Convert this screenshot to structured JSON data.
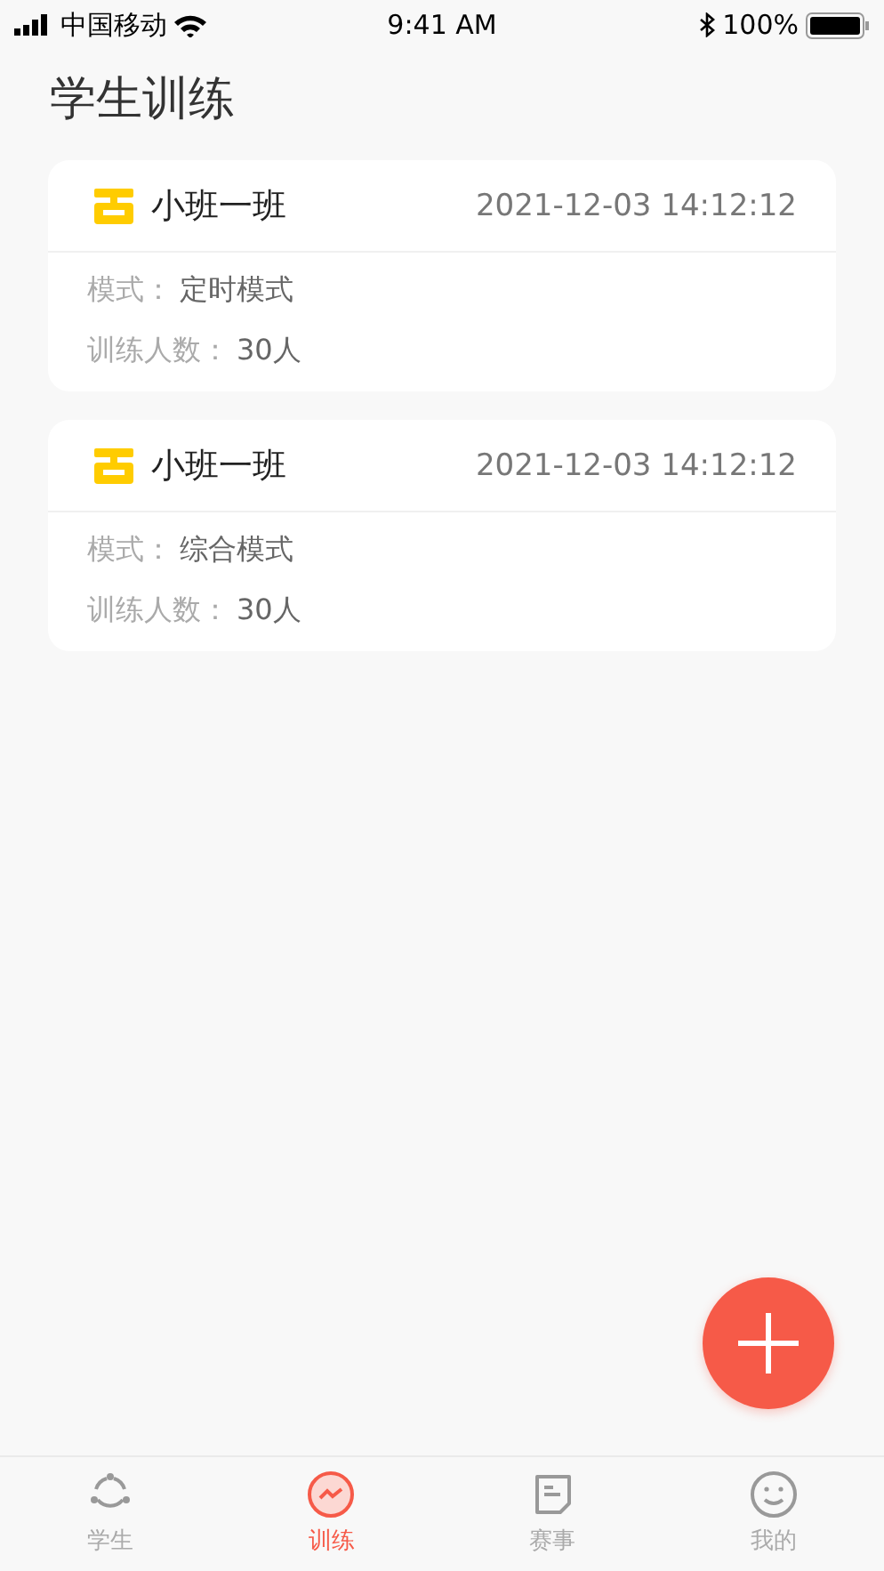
{
  "status_bar": {
    "carrier": "中国移动",
    "time": "9:41 AM",
    "battery": "100%"
  },
  "title": "学生训练",
  "cards": [
    {
      "name": "小班一班",
      "time": "2021-12-03 14:12:12",
      "mode_label": "模式：",
      "mode": "定时模式",
      "count_label": "训练人数：",
      "count": "30人"
    },
    {
      "name": "小班一班",
      "time": "2021-12-03 14:12:12",
      "mode_label": "模式：",
      "mode": "综合模式",
      "count_label": "训练人数：",
      "count": "30人"
    }
  ],
  "tabs": [
    {
      "kind": "students",
      "label": "学生",
      "selected": false
    },
    {
      "kind": "training",
      "label": "训练",
      "selected": true
    },
    {
      "kind": "events",
      "label": "赛事",
      "selected": false
    },
    {
      "kind": "profile",
      "label": "我的",
      "selected": false
    }
  ]
}
